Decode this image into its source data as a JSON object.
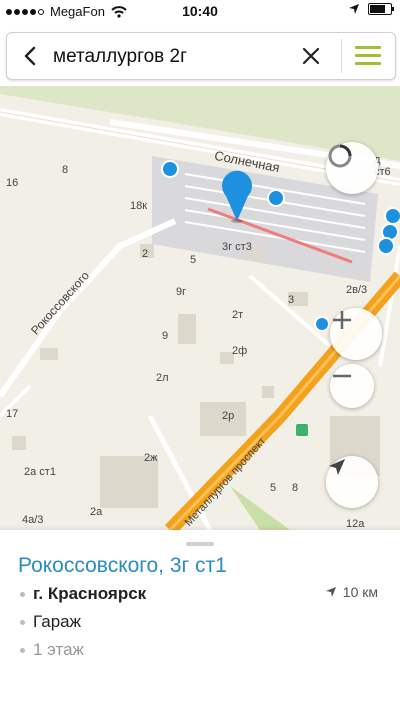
{
  "status": {
    "carrier": "MegaFon",
    "time": "10:40"
  },
  "search": {
    "query": "металлургов 2г"
  },
  "map": {
    "street_labels": [
      "Солнечная",
      "Рокоссовского",
      "Металлургов проспект"
    ],
    "building_labels": [
      "16",
      "8",
      "18к",
      "3г ст3",
      "5",
      "2",
      "9г",
      "9",
      "2т",
      "2ф",
      "2л",
      "2р",
      "3",
      "2в/3",
      "17",
      "2ж",
      "2а ст1",
      "2а",
      "4а/3",
      "5",
      "8",
      "12а",
      "д ст6"
    ]
  },
  "card": {
    "title": "Рокоссовского, 3г ст1",
    "city": "г. Красноярск",
    "type": "Гараж",
    "floors": "1 этаж",
    "distance": "10 км"
  },
  "colors": {
    "accent": "#2b8cc0",
    "menu": "#9cc131",
    "road": "#f4a21b"
  }
}
